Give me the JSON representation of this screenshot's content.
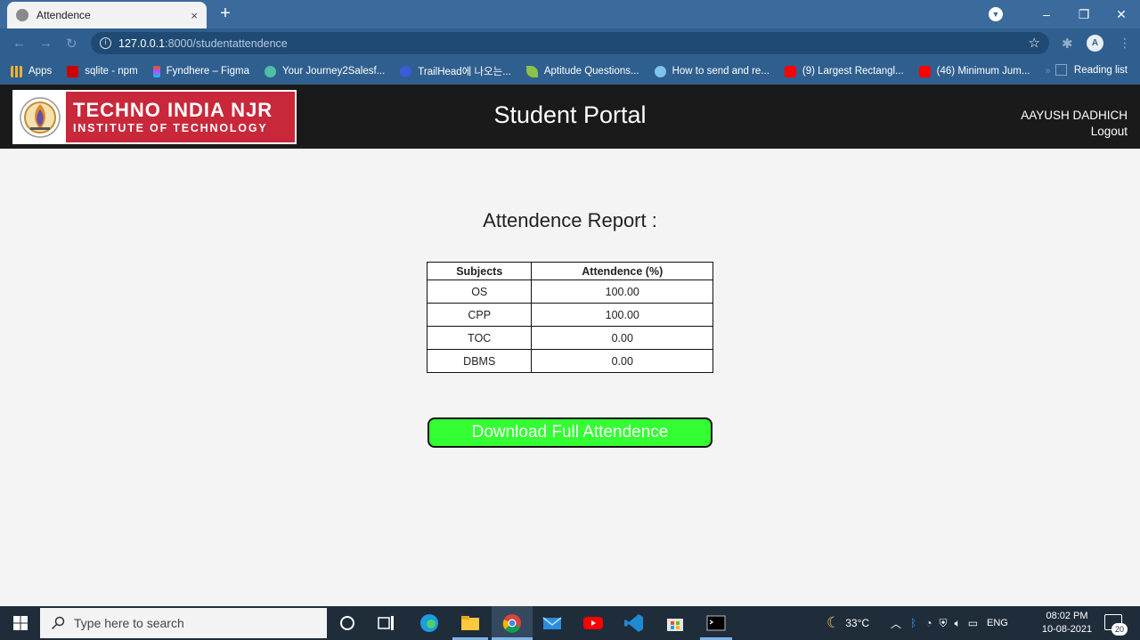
{
  "browser": {
    "tab_title": "Attendence",
    "tab_close": "×",
    "new_tab": "+",
    "url_host": "127.0.0.1",
    "url_path": ":8000/studentattendence",
    "profile_initial": "A",
    "bookmarks": [
      {
        "label": "Apps",
        "icon": "apps-grid-icon",
        "color": "#f2b134"
      },
      {
        "label": "sqlite - npm",
        "icon": "npm-icon",
        "color": "#cb0000"
      },
      {
        "label": "Fyndhere – Figma",
        "icon": "figma-icon",
        "color": "#a259ff"
      },
      {
        "label": "Your Journey2Salesf...",
        "icon": "trailhead-icon",
        "color": "#4fbfa5"
      },
      {
        "label": "TrailHead에 나오는...",
        "icon": "globe-icon",
        "color": "#3b5bdb"
      },
      {
        "label": "Aptitude Questions...",
        "icon": "leaf-icon",
        "color": "#8bc34a"
      },
      {
        "label": "How to send and re...",
        "icon": "site-icon",
        "color": "#7cc4e8"
      },
      {
        "label": "(9) Largest Rectangl...",
        "icon": "youtube-icon",
        "color": "#ff0000"
      },
      {
        "label": "(46) Minimum Jum...",
        "icon": "youtube-icon",
        "color": "#ff0000"
      }
    ],
    "bookmark_overflow": "»",
    "reading_list": "Reading list"
  },
  "header": {
    "logo_line1": "TECHNO INDIA NJR",
    "logo_line2": "INSTITUTE OF TECHNOLOGY",
    "portal_title": "Student Portal",
    "user_name": "AAYUSH DADHICH",
    "logout": "Logout"
  },
  "report": {
    "heading": "Attendence Report :",
    "columns": [
      "Subjects",
      "Attendence (%)"
    ],
    "rows": [
      {
        "subject": "OS",
        "attendance": "100.00"
      },
      {
        "subject": "CPP",
        "attendance": "100.00"
      },
      {
        "subject": "TOC",
        "attendance": "0.00"
      },
      {
        "subject": "DBMS",
        "attendance": "0.00"
      }
    ],
    "download_label": "Download Full Attendence",
    "download_color": "#33ff33"
  },
  "taskbar": {
    "search_placeholder": "Type here to search",
    "temperature": "33°C",
    "language": "ENG",
    "time": "08:02 PM",
    "date": "10-08-2021",
    "notification_count": "20"
  }
}
